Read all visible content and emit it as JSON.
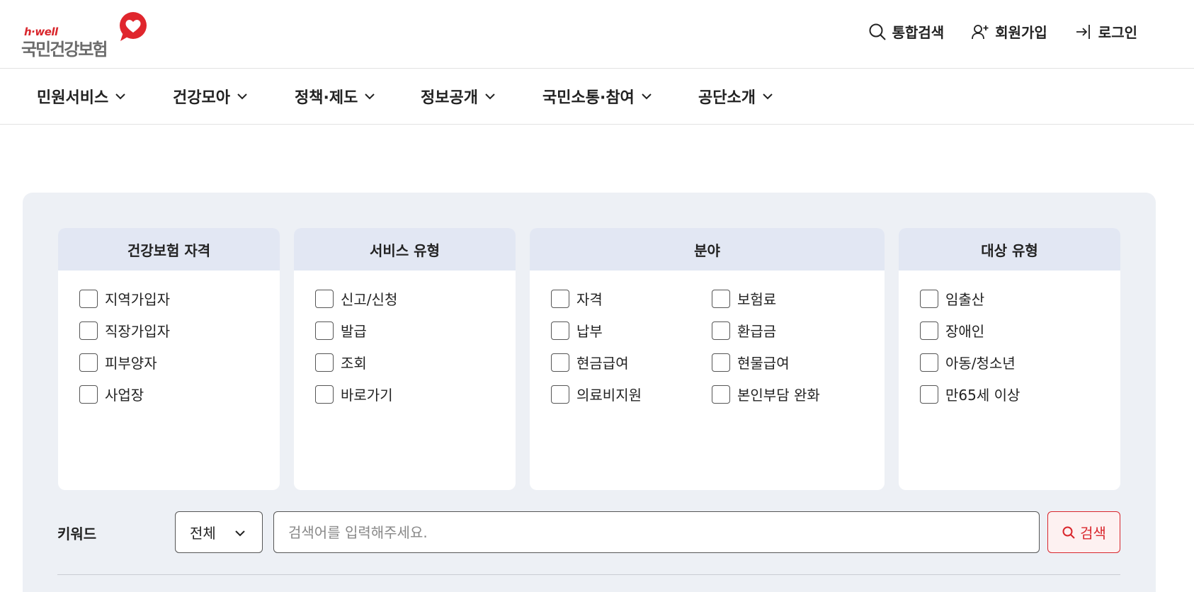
{
  "header": {
    "logo": {
      "brand_top": "h·well",
      "brand_main": "국민건강보험"
    },
    "util": [
      {
        "label": "통합검색",
        "icon": "search-icon"
      },
      {
        "label": "회원가입",
        "icon": "user-add-icon"
      },
      {
        "label": "로그인",
        "icon": "login-icon"
      }
    ]
  },
  "gnb": [
    {
      "label": "민원서비스"
    },
    {
      "label": "건강모아"
    },
    {
      "label": "정책·제도"
    },
    {
      "label": "정보공개"
    },
    {
      "label": "국민소통·참여"
    },
    {
      "label": "공단소개"
    }
  ],
  "filters": [
    {
      "title": "건강보험 자격",
      "options": [
        "지역가입자",
        "직장가입자",
        "피부양자",
        "사업장"
      ]
    },
    {
      "title": "서비스 유형",
      "options": [
        "신고/신청",
        "발급",
        "조회",
        "바로가기"
      ]
    },
    {
      "title": "분야",
      "options": [
        "자격",
        "보험료",
        "납부",
        "환급금",
        "현금급여",
        "현물급여",
        "의료비지원",
        "본인부담 완화"
      ]
    },
    {
      "title": "대상 유형",
      "options": [
        "임출산",
        "장애인",
        "아동/청소년",
        "만65세 이상"
      ]
    }
  ],
  "search": {
    "label": "키워드",
    "scope": "전체",
    "placeholder": "검색어를 입력해주세요.",
    "button": "검색"
  },
  "colors": {
    "accent": "#d9262c",
    "panel_bg": "#edf0f5",
    "panel_head": "#e2e7f3"
  }
}
